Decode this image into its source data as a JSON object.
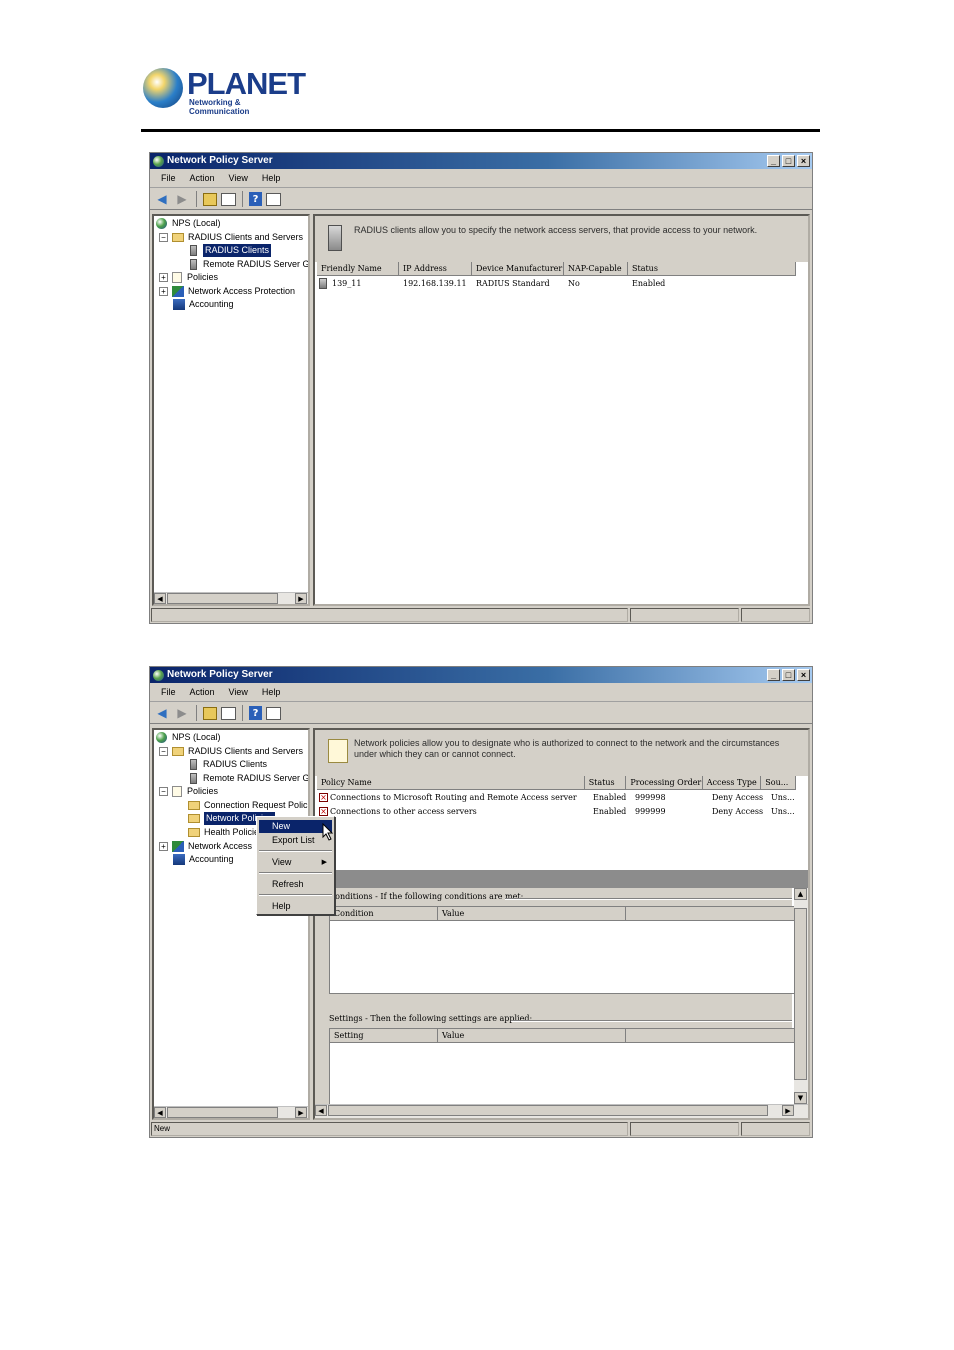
{
  "header": {
    "brand": "PLANET",
    "tagline": "Networking & Communication"
  },
  "window1": {
    "title": "Network Policy Server",
    "menu": [
      "File",
      "Action",
      "View",
      "Help"
    ],
    "tree": {
      "root": "NPS (Local)",
      "radius_group": "RADIUS Clients and Servers",
      "radius_clients": "RADIUS Clients",
      "remote_groups": "Remote RADIUS Server G",
      "policies": "Policies",
      "nap": "Network Access Protection",
      "accounting": "Accounting"
    },
    "banner": "RADIUS clients allow you to specify the network access servers, that provide access to your network.",
    "columns": [
      "Friendly Name",
      "IP Address",
      "Device Manufacturer",
      "NAP-Capable",
      "Status"
    ],
    "rows": [
      {
        "name": "139_11",
        "ip": "192.168.139.11",
        "manufacturer": "RADIUS Standard",
        "nap": "No",
        "status": "Enabled"
      }
    ]
  },
  "window2": {
    "title": "Network Policy Server",
    "menu": [
      "File",
      "Action",
      "View",
      "Help"
    ],
    "tree": {
      "root": "NPS (Local)",
      "radius_group": "RADIUS Clients and Servers",
      "radius_clients": "RADIUS Clients",
      "remote_groups": "Remote RADIUS Server G",
      "policies": "Policies",
      "connection_request": "Connection Request Polici",
      "network_policies": "Network Policies",
      "health_policies": "Health Policie",
      "nap": "Network Access",
      "accounting": "Accounting"
    },
    "banner": "Network policies allow you to designate who is authorized to connect to the network and the circumstances under which they can or cannot connect.",
    "columns": [
      "Policy Name",
      "Status",
      "Processing Order",
      "Access Type",
      "Sou..."
    ],
    "rows": [
      {
        "name": "Connections to Microsoft Routing and Remote Access server",
        "status": "Enabled",
        "order": "999998",
        "access": "Deny Access",
        "source": "Uns..."
      },
      {
        "name": "Connections to other access servers",
        "status": "Enabled",
        "order": "999999",
        "access": "Deny Access",
        "source": "Uns..."
      }
    ],
    "conditions_label": "Conditions - If the following conditions are met:",
    "conditions_cols": [
      "Condition",
      "Value"
    ],
    "settings_label": "Settings - Then the following settings are applied:",
    "settings_cols": [
      "Setting",
      "Value"
    ],
    "status_text": "New",
    "context_menu": [
      "New",
      "Export List",
      "View",
      "Refresh",
      "Help"
    ]
  }
}
